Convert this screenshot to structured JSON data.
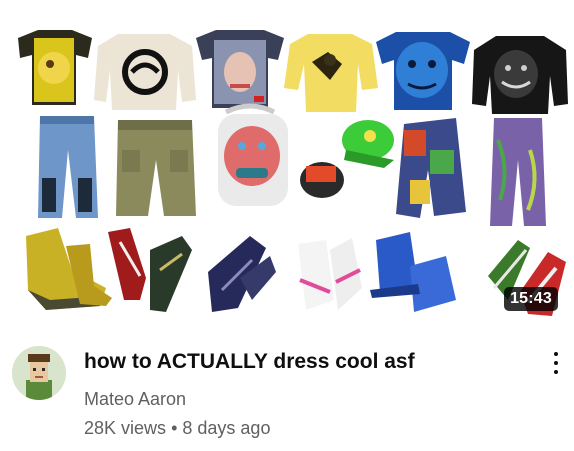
{
  "video": {
    "title": "how to ACTUALLY dress cool asf",
    "duration": "15:43",
    "channel": "Mateo Aaron",
    "views": "28K views",
    "separator": "•",
    "age": "8 days ago"
  },
  "icons": {
    "menu": "more-vert-icon"
  },
  "colors": {
    "title": "#0f0f0f",
    "secondary": "#606060",
    "duration_bg": "#000000"
  },
  "thumbnail_items": [
    "yellow-graphic-tee",
    "aphex-sweater",
    "portrait-tee",
    "yellow-shirt",
    "blue-face-tee",
    "black-gorilla-sweater",
    "blue-jeans",
    "olive-cargo-pants",
    "face-backpack",
    "cap-pair",
    "patch-shorts",
    "purple-jeans",
    "yellow-boots",
    "adidas-sneakers",
    "navy-sneakers",
    "white-pink-sneakers",
    "blue-boots",
    "green-red-sneakers"
  ]
}
